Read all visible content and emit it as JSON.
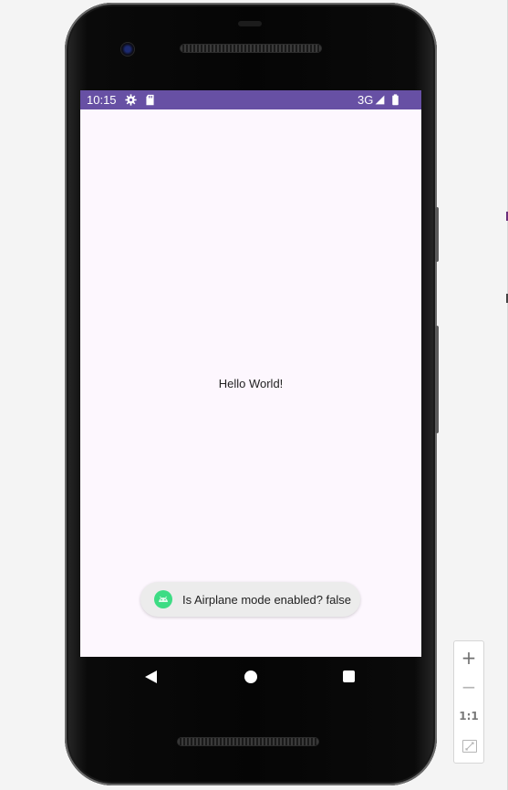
{
  "status_bar": {
    "time": "10:15",
    "network": "3G",
    "icons": [
      "gear-icon",
      "sd-card-icon",
      "signal-icon",
      "battery-icon"
    ],
    "color": "#6750a4"
  },
  "app": {
    "hello_text": "Hello World!",
    "background": "#fdf7fe"
  },
  "toast": {
    "message": "Is Airplane mode enabled? false",
    "icon": "android-icon",
    "icon_color": "#3ddc84"
  },
  "nav_bar": {
    "buttons": [
      "back-icon",
      "home-icon",
      "recents-icon"
    ]
  },
  "zoom_toolbar": {
    "zoom_in_label": "+",
    "zoom_out_label": "−",
    "actual_size_label": "1:1",
    "fit_icon": "fit-screen-icon"
  }
}
